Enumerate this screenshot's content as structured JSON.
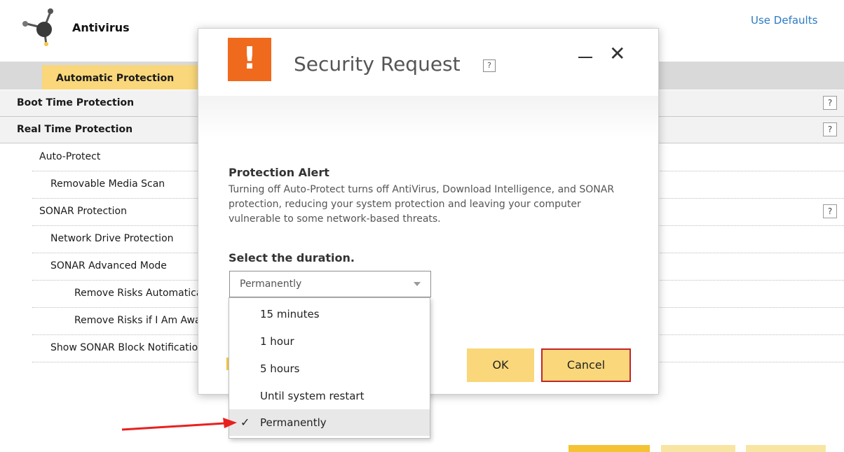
{
  "app": {
    "title": "Antivirus",
    "use_defaults": "Use Defaults"
  },
  "tabs": {
    "active": "Automatic Protection"
  },
  "settings": {
    "sections": [
      {
        "label": "Boot Time Protection"
      },
      {
        "label": "Real Time Protection"
      }
    ],
    "items": [
      {
        "label": "Auto-Protect"
      },
      {
        "label": "Removable Media Scan"
      },
      {
        "label": "SONAR Protection"
      },
      {
        "label": "Network Drive Protection"
      },
      {
        "label": "SONAR Advanced Mode"
      },
      {
        "label": "Remove Risks Automatically"
      },
      {
        "label": "Remove Risks if I Am Away"
      },
      {
        "label": "Show SONAR Block Notifications"
      }
    ],
    "help_glyph": "?"
  },
  "dialog": {
    "title": "Security Request",
    "help_glyph": "?",
    "close_glyph": "✕",
    "alert_icon_glyph": "!",
    "alert_heading": "Protection Alert",
    "alert_body": "Turning off Auto-Protect turns off AntiVirus, Download Intelligence, and SONAR protection, reducing your system protection and leaving your computer vulnerable to some network-based threats.",
    "duration_heading": "Select the duration.",
    "duration_selected": "Permanently",
    "ok_label": "OK",
    "cancel_label": "Cancel"
  },
  "dropdown": {
    "options": [
      {
        "label": "15 minutes",
        "selected": false
      },
      {
        "label": "1 hour",
        "selected": false
      },
      {
        "label": "5 hours",
        "selected": false
      },
      {
        "label": "Until system restart",
        "selected": false
      },
      {
        "label": "Permanently",
        "selected": true
      }
    ],
    "check_glyph": "✓"
  },
  "colors": {
    "accent_yellow": "#f9d77a",
    "alert_orange": "#f06a1e",
    "link_blue": "#2b7bc3",
    "cancel_border": "#c0262d",
    "annotation_arrow": "#e8211f"
  }
}
